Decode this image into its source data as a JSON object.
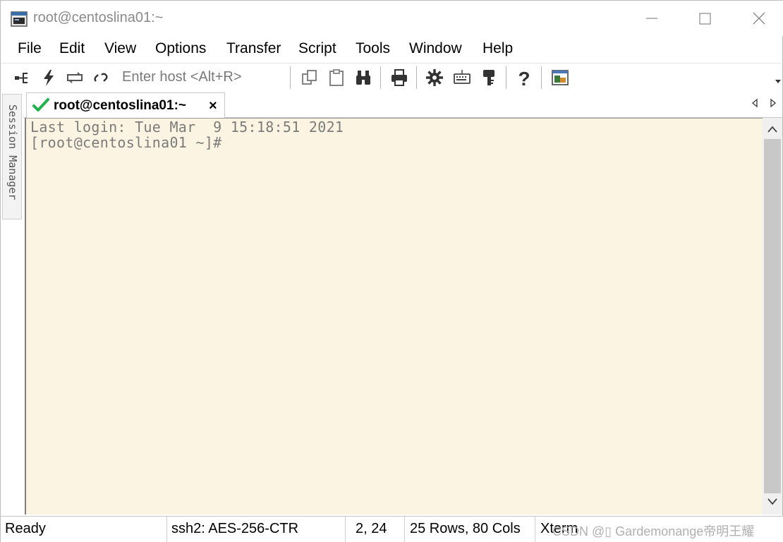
{
  "window": {
    "title": "root@centoslina01:~"
  },
  "menu": [
    "File",
    "Edit",
    "View",
    "Options",
    "Transfer",
    "Script",
    "Tools",
    "Window",
    "Help"
  ],
  "toolbar": {
    "host_placeholder": "Enter host <Alt+R>",
    "icons": [
      "connect-icon",
      "quick-connect-icon",
      "reconnect-icon",
      "disconnect-icon",
      "copy-icon",
      "paste-icon",
      "find-icon",
      "print-icon",
      "settings-icon",
      "keymap-icon",
      "key-icon",
      "help-icon",
      "sftp-icon"
    ]
  },
  "sidebar": {
    "session_manager": "Session Manager"
  },
  "tabs": [
    {
      "label": "root@centoslina01:~",
      "close": "×",
      "status": "connected"
    }
  ],
  "terminal": {
    "lines": [
      "Last login: Tue Mar  9 15:18:51 2021",
      "[root@centoslina01 ~]#"
    ],
    "background": "#fcf4e3",
    "text_color": "#7b7b7b"
  },
  "status": {
    "ready": "Ready",
    "cipher": "ssh2: AES-256-CTR",
    "cursor": "2,  24",
    "size": "25 Rows, 80 Cols",
    "term": "Xterm",
    "watermark": "CSDN @▯ Gardemonange帝明王耀"
  },
  "colors": {
    "check": "#22b14c",
    "toolbar_icon": "#333333"
  }
}
